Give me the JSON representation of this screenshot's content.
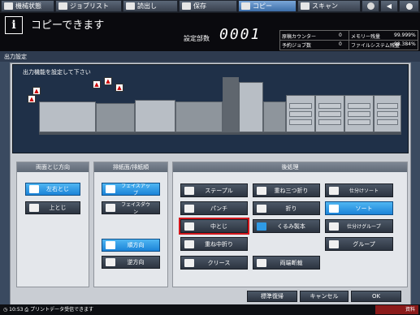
{
  "tabs": [
    {
      "label": "機械状態",
      "active": false
    },
    {
      "label": "ジョブリスト",
      "active": false
    },
    {
      "label": "読出し",
      "active": false
    },
    {
      "label": "保存",
      "active": false
    },
    {
      "label": "コピー",
      "active": true
    },
    {
      "label": "スキャン",
      "active": false
    }
  ],
  "header": {
    "info_icon": "i",
    "title": "コピーできます",
    "copies_label": "設定部数",
    "copies_value": "0001"
  },
  "status": {
    "dest_counter_label": "原稿カウンター",
    "dest_counter_value": "0",
    "memory_label": "メモリー残量",
    "memory_value": "99.999%",
    "next_job_label": "予約ジョブ数",
    "next_job_value": "0",
    "filesystem_label": "ファイルシステム残量",
    "filesystem_value": "98.384%"
  },
  "panel": {
    "label": "出力設定",
    "prompt": "出力機能を設定して下さい"
  },
  "groups": {
    "binding": {
      "title": "両面とじ方向",
      "left": "左右とじ",
      "top": "上とじ"
    },
    "eject": {
      "title": "排紙面/排紙順",
      "face_up": "フェイスアップ",
      "face_down": "フェイスダウン",
      "normal_order": "順方向",
      "reverse_order": "逆方向"
    },
    "finishing": {
      "title": "後処理",
      "staple": "ステープル",
      "punch": "パンチ",
      "saddle": "中とじ",
      "half_fold": "重ね中折り",
      "crease": "クリース",
      "tri_fold": "重ね三つ折り",
      "fold": "折り",
      "perfect_bind": "くるみ製本",
      "trim": "両端断裁",
      "sort_output": "仕分けソート",
      "sort": "ソート",
      "group_sort": "仕分けグループ",
      "group": "グループ"
    }
  },
  "bottom": {
    "default_label": "標準復帰",
    "cancel_label": "キャンセル",
    "ok_label": "OK"
  },
  "footer": {
    "time": "10:53",
    "message": "プリントデータ受信できます",
    "right_label": "資料"
  },
  "colors": {
    "selected": "#2f9be6",
    "highlight_border": "#d2171c",
    "header_bg": "#0a0a0e"
  }
}
